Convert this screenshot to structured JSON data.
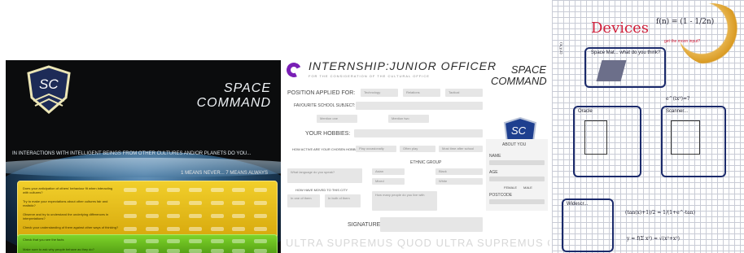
{
  "panel_left": {
    "badge_text": "SC",
    "title_line1": "SPACE",
    "title_line2": "COMMAND",
    "intro": "In interactions with intelligent beings from other cultures and/or planets do you...",
    "scale": "1 means never... 7 means always",
    "yellow_questions": [
      "Does your anticipation of others' behaviour fit when interacting with cultures?",
      "Try to make your expectations about other cultures fair and realistic?",
      "Observe and try to understand the underlying differences in interpretations?",
      "Check your understanding of them against other ways of thinking?"
    ],
    "green_questions": [
      "Check that you see the facts",
      "Make sure to ask why people behave as they do?"
    ]
  },
  "panel_middle": {
    "title": "INTERNSHIP:JUNIOR OFFICER",
    "subtitle": "For the consideration of the Cultural Office",
    "position_label": "Position Applied for:",
    "position_options": [
      "Technology",
      "Relations",
      "Tactical"
    ],
    "favourite_subject_label": "Favourite school subject:",
    "small_field_1": "Mention one",
    "small_field_2": "Mention two",
    "hobbies_label": "Your Hobbies:",
    "hobby_question": "How active are your chosen hobbies?",
    "hobby_options": [
      "Play occasionally",
      "Often play",
      "Most time after school"
    ],
    "ethnic_label": "Ethnic Group",
    "side_prompt_1": "What language do you speak?",
    "side_prompt_2": "How have moved to this city",
    "side_prompt_3": "How many people do you live with",
    "left_choice_1": "In one of them",
    "left_choice_2": "In both of them",
    "ethnic_options": [
      "Asian",
      "Black",
      "Mixed",
      "White"
    ],
    "signature_label": "Signature",
    "space_title_line1": "SPACE",
    "space_title_line2": "COMMAND",
    "badge_text": "SC",
    "about_label": "About you",
    "name_label": "Name",
    "age_label": "Age",
    "gender_options": [
      "Female",
      "Male"
    ],
    "postcode_label": "Postcode",
    "watermark": "ULTRA SUPREMUS QUOD ULTRA SUPREMUS QUOD"
  },
  "panel_right": {
    "heading": "Devices",
    "red_note": "get the moon input?",
    "equation_top": "f(n) = (1 - 1/2n)",
    "equation_mid": "e^(ix²)=?",
    "sketch1_label": "Space Mat... what do you think?",
    "sketch2_label": "Oracle",
    "sketch3_label": "Scanner...",
    "sketch4_label": "Widescr...",
    "eq_bottom_1": "(tan(x)+1)/2 = 1/(1+e^-tan)",
    "eq_bottom_2": "y = f(Σ x²) = √(x²+x²)",
    "eq_side": "(x,y,z)"
  },
  "colors": {
    "yellow": "#e6be1f",
    "green": "#6fc325",
    "purple": "#7a1fb6",
    "pen_red": "#d11f3a",
    "pen_blue": "#1b2a6b"
  }
}
